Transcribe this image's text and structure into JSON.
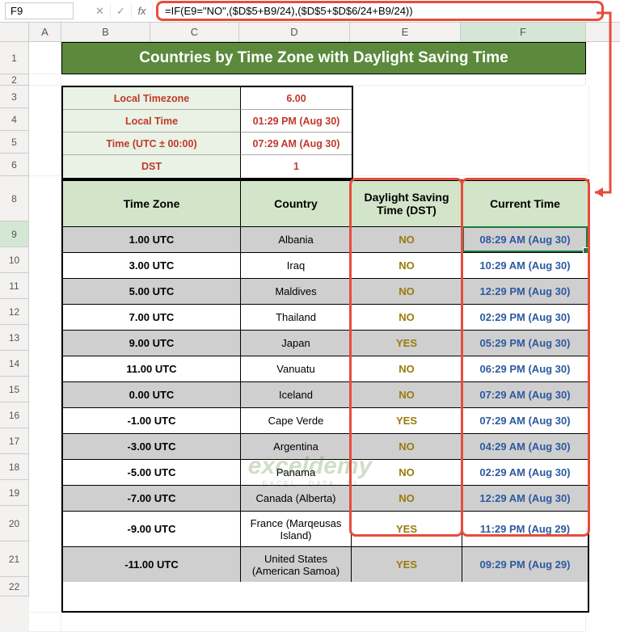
{
  "name_box": "F9",
  "formula": "=IF(E9=\"NO\",($D$5+B9/24),($D$5+$D$6/24+B9/24))",
  "columns": [
    "A",
    "B",
    "C",
    "D",
    "E",
    "F"
  ],
  "rows": [
    "1",
    "2",
    "3",
    "4",
    "5",
    "6",
    "8",
    "9",
    "10",
    "11",
    "12",
    "13",
    "14",
    "15",
    "16",
    "17",
    "18",
    "19",
    "20",
    "21",
    "22"
  ],
  "title": "Countries by Time Zone with Daylight Saving Time",
  "info": [
    {
      "label": "Local Timezone",
      "value": "6.00"
    },
    {
      "label": "Local Time",
      "value": "01:29 PM (Aug 30)"
    },
    {
      "label": "Time (UTC ± 00:00)",
      "value": "07:29 AM (Aug 30)"
    },
    {
      "label": "DST",
      "value": "1"
    }
  ],
  "headers": {
    "tz": "Time Zone",
    "country": "Country",
    "dst": "Daylight Saving Time (DST)",
    "time": "Current Time"
  },
  "table": [
    {
      "tz": "1.00 UTC",
      "country": "Albania",
      "dst": "NO",
      "time": "08:29 AM (Aug 30)"
    },
    {
      "tz": "3.00 UTC",
      "country": "Iraq",
      "dst": "NO",
      "time": "10:29 AM (Aug 30)"
    },
    {
      "tz": "5.00 UTC",
      "country": "Maldives",
      "dst": "NO",
      "time": "12:29 PM (Aug 30)"
    },
    {
      "tz": "7.00 UTC",
      "country": "Thailand",
      "dst": "NO",
      "time": "02:29 PM (Aug 30)"
    },
    {
      "tz": "9.00 UTC",
      "country": "Japan",
      "dst": "YES",
      "time": "05:29 PM (Aug 30)"
    },
    {
      "tz": "11.00 UTC",
      "country": "Vanuatu",
      "dst": "NO",
      "time": "06:29 PM (Aug 30)"
    },
    {
      "tz": "0.00 UTC",
      "country": "Iceland",
      "dst": "NO",
      "time": "07:29 AM (Aug 30)"
    },
    {
      "tz": "-1.00 UTC",
      "country": "Cape Verde",
      "dst": "YES",
      "time": "07:29 AM (Aug 30)"
    },
    {
      "tz": "-3.00 UTC",
      "country": "Argentina",
      "dst": "NO",
      "time": "04:29 AM (Aug 30)"
    },
    {
      "tz": "-5.00 UTC",
      "country": "Panama",
      "dst": "NO",
      "time": "02:29 AM (Aug 30)"
    },
    {
      "tz": "-7.00 UTC",
      "country": "Canada (Alberta)",
      "dst": "NO",
      "time": "12:29 AM (Aug 30)"
    },
    {
      "tz": "-9.00 UTC",
      "country": "France (Marqeusas Island)",
      "dst": "YES",
      "time": "11:29 PM (Aug 29)"
    },
    {
      "tz": "-11.00 UTC",
      "country": "United States (American Samoa)",
      "dst": "YES",
      "time": "09:29 PM (Aug 29)"
    }
  ],
  "watermark": {
    "big": "exceldemy",
    "small": "EXCEL · DATA · BI"
  },
  "colors": {
    "accent": "#e74c3c",
    "header": "#5b8a3c",
    "selection": "#1a7a3e"
  }
}
